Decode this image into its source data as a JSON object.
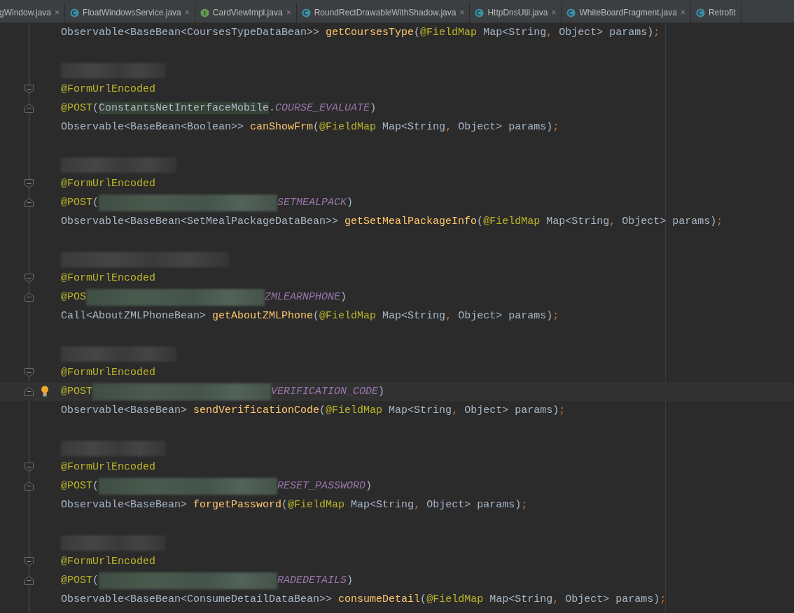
{
  "tabs": [
    {
      "label": "gWindow.java",
      "kind": "plain",
      "close": "×"
    },
    {
      "label": "FloatWindowsService.java",
      "kind": "class",
      "close": "×"
    },
    {
      "label": "CardViewImpl.java",
      "kind": "interface",
      "close": "×"
    },
    {
      "label": "RoundRectDrawableWithShadow.java",
      "kind": "class",
      "close": "×"
    },
    {
      "label": "HttpDnsUtil.java",
      "kind": "class",
      "close": "×"
    },
    {
      "label": "WhiteBoardFragment.java",
      "kind": "class",
      "close": "×"
    },
    {
      "label": "Retrofit",
      "kind": "class"
    }
  ],
  "lines": [
    {
      "kind": "plain",
      "tokens": [
        {
          "kind": "plain",
          "text": "Observable<BaseBean<CoursesTypeDataBean>> "
        },
        {
          "kind": "method",
          "text": "getCoursesType"
        },
        {
          "kind": "plain",
          "text": "("
        },
        {
          "kind": "annotation",
          "text": "@FieldMap"
        },
        {
          "kind": "plain",
          "text": " Map<String"
        },
        {
          "kind": "punct",
          "text": ", "
        },
        {
          "kind": "plain",
          "text": "Object> params)"
        },
        {
          "kind": "punct",
          "text": ";"
        }
      ]
    },
    {
      "kind": "blank"
    },
    {
      "kind": "plain",
      "tokens": [
        {
          "kind": "blur-short"
        }
      ]
    },
    {
      "kind": "fold-start",
      "tokens": [
        {
          "kind": "annotation",
          "text": "@FormUrlEncoded"
        }
      ]
    },
    {
      "kind": "fold-end",
      "tokens": [
        {
          "kind": "annotation",
          "text": "@POST"
        },
        {
          "kind": "plain",
          "text": "("
        },
        {
          "kind": "usage",
          "text": "ConstantsNetInterfaceMobile"
        },
        {
          "kind": "plain",
          "text": "."
        },
        {
          "kind": "constant",
          "text": "COURSE_EVALUATE"
        },
        {
          "kind": "plain",
          "text": ")"
        }
      ]
    },
    {
      "kind": "plain",
      "tokens": [
        {
          "kind": "plain",
          "text": "Observable<BaseBean<Boolean>> "
        },
        {
          "kind": "method",
          "text": "canShowFrm"
        },
        {
          "kind": "plain",
          "text": "("
        },
        {
          "kind": "annotation",
          "text": "@FieldMap"
        },
        {
          "kind": "plain",
          "text": " Map<String"
        },
        {
          "kind": "punct",
          "text": ", "
        },
        {
          "kind": "plain",
          "text": "Object> params)"
        },
        {
          "kind": "punct",
          "text": ";"
        }
      ]
    },
    {
      "kind": "blank"
    },
    {
      "kind": "plain",
      "tokens": [
        {
          "kind": "blur-medium"
        }
      ]
    },
    {
      "kind": "fold-start",
      "tokens": [
        {
          "kind": "annotation",
          "text": "@FormUrlEncoded"
        }
      ]
    },
    {
      "kind": "fold-end",
      "tokens": [
        {
          "kind": "annotation",
          "text": "@POST"
        },
        {
          "kind": "plain",
          "text": "("
        },
        {
          "kind": "mask"
        },
        {
          "kind": "constant",
          "text": "SETMEALPACK"
        },
        {
          "kind": "plain",
          "text": ")"
        }
      ]
    },
    {
      "kind": "plain",
      "tokens": [
        {
          "kind": "plain",
          "text": "Observable<BaseBean<SetMealPackageDataBean>> "
        },
        {
          "kind": "method",
          "text": "getSetMealPackageInfo"
        },
        {
          "kind": "plain",
          "text": "("
        },
        {
          "kind": "annotation",
          "text": "@FieldMap"
        },
        {
          "kind": "plain",
          "text": " Map<String"
        },
        {
          "kind": "punct",
          "text": ", "
        },
        {
          "kind": "plain",
          "text": "Object> params)"
        },
        {
          "kind": "punct",
          "text": ";"
        }
      ]
    },
    {
      "kind": "blank"
    },
    {
      "kind": "plain",
      "tokens": [
        {
          "kind": "blur-wide"
        }
      ]
    },
    {
      "kind": "fold-start",
      "tokens": [
        {
          "kind": "annotation",
          "text": "@FormUrlEncoded"
        }
      ]
    },
    {
      "kind": "fold-end",
      "tokens": [
        {
          "kind": "annotation",
          "text": "@POS"
        },
        {
          "kind": "mask"
        },
        {
          "kind": "constant",
          "text": "ZMLEARNPHONE"
        },
        {
          "kind": "plain",
          "text": ")"
        }
      ]
    },
    {
      "kind": "plain",
      "tokens": [
        {
          "kind": "plain",
          "text": "Call<AboutZMLPhoneBean> "
        },
        {
          "kind": "method",
          "text": "getAboutZMLPhone"
        },
        {
          "kind": "plain",
          "text": "("
        },
        {
          "kind": "annotation",
          "text": "@FieldMap"
        },
        {
          "kind": "plain",
          "text": " Map<String"
        },
        {
          "kind": "punct",
          "text": ", "
        },
        {
          "kind": "plain",
          "text": "Object> params)"
        },
        {
          "kind": "punct",
          "text": ";"
        }
      ]
    },
    {
      "kind": "blank"
    },
    {
      "kind": "plain",
      "tokens": [
        {
          "kind": "blur-medium"
        }
      ]
    },
    {
      "kind": "fold-start",
      "tokens": [
        {
          "kind": "annotation",
          "text": "@FormUrlEncoded"
        }
      ]
    },
    {
      "kind": "fold-end",
      "current": true,
      "bulb": true,
      "tokens": [
        {
          "kind": "annotation",
          "text": "@POST"
        },
        {
          "kind": "mask"
        },
        {
          "kind": "constant",
          "text": "VERIFICATION_CODE"
        },
        {
          "kind": "plain",
          "text": ")"
        }
      ]
    },
    {
      "kind": "plain",
      "tokens": [
        {
          "kind": "plain",
          "text": "Observable<BaseBean> "
        },
        {
          "kind": "method",
          "text": "sendVerificationCode"
        },
        {
          "kind": "plain",
          "text": "("
        },
        {
          "kind": "annotation",
          "text": "@FieldMap"
        },
        {
          "kind": "plain",
          "text": " Map<String"
        },
        {
          "kind": "punct",
          "text": ", "
        },
        {
          "kind": "plain",
          "text": "Object> params)"
        },
        {
          "kind": "punct",
          "text": ";"
        }
      ]
    },
    {
      "kind": "blank"
    },
    {
      "kind": "plain",
      "tokens": [
        {
          "kind": "blur-short"
        }
      ]
    },
    {
      "kind": "fold-start",
      "tokens": [
        {
          "kind": "annotation",
          "text": "@FormUrlEncoded"
        }
      ]
    },
    {
      "kind": "fold-end",
      "tokens": [
        {
          "kind": "annotation",
          "text": "@POST"
        },
        {
          "kind": "plain",
          "text": "("
        },
        {
          "kind": "mask"
        },
        {
          "kind": "constant",
          "text": "RESET_PASSWORD"
        },
        {
          "kind": "plain",
          "text": ")"
        }
      ]
    },
    {
      "kind": "plain",
      "tokens": [
        {
          "kind": "plain",
          "text": "Observable<BaseBean> "
        },
        {
          "kind": "method",
          "text": "forgetPassword"
        },
        {
          "kind": "plain",
          "text": "("
        },
        {
          "kind": "annotation",
          "text": "@FieldMap"
        },
        {
          "kind": "plain",
          "text": " Map<String"
        },
        {
          "kind": "punct",
          "text": ", "
        },
        {
          "kind": "plain",
          "text": "Object> params)"
        },
        {
          "kind": "punct",
          "text": ";"
        }
      ]
    },
    {
      "kind": "blank"
    },
    {
      "kind": "plain",
      "tokens": [
        {
          "kind": "blur-short"
        }
      ]
    },
    {
      "kind": "fold-start",
      "tokens": [
        {
          "kind": "annotation",
          "text": "@FormUrlEncoded"
        }
      ]
    },
    {
      "kind": "fold-end",
      "tokens": [
        {
          "kind": "annotation",
          "text": "@POST"
        },
        {
          "kind": "plain",
          "text": "("
        },
        {
          "kind": "mask"
        },
        {
          "kind": "constant",
          "text": "RADEDETAILS"
        },
        {
          "kind": "plain",
          "text": ")"
        }
      ]
    },
    {
      "kind": "plain",
      "tokens": [
        {
          "kind": "plain",
          "text": "Observable<BaseBean<ConsumeDetailDataBean>> "
        },
        {
          "kind": "method",
          "text": "consumeDetail"
        },
        {
          "kind": "plain",
          "text": "("
        },
        {
          "kind": "annotation",
          "text": "@FieldMap"
        },
        {
          "kind": "plain",
          "text": " Map<String"
        },
        {
          "kind": "punct",
          "text": ", "
        },
        {
          "kind": "plain",
          "text": "Object> params)"
        },
        {
          "kind": "punct",
          "text": ";"
        }
      ]
    }
  ]
}
